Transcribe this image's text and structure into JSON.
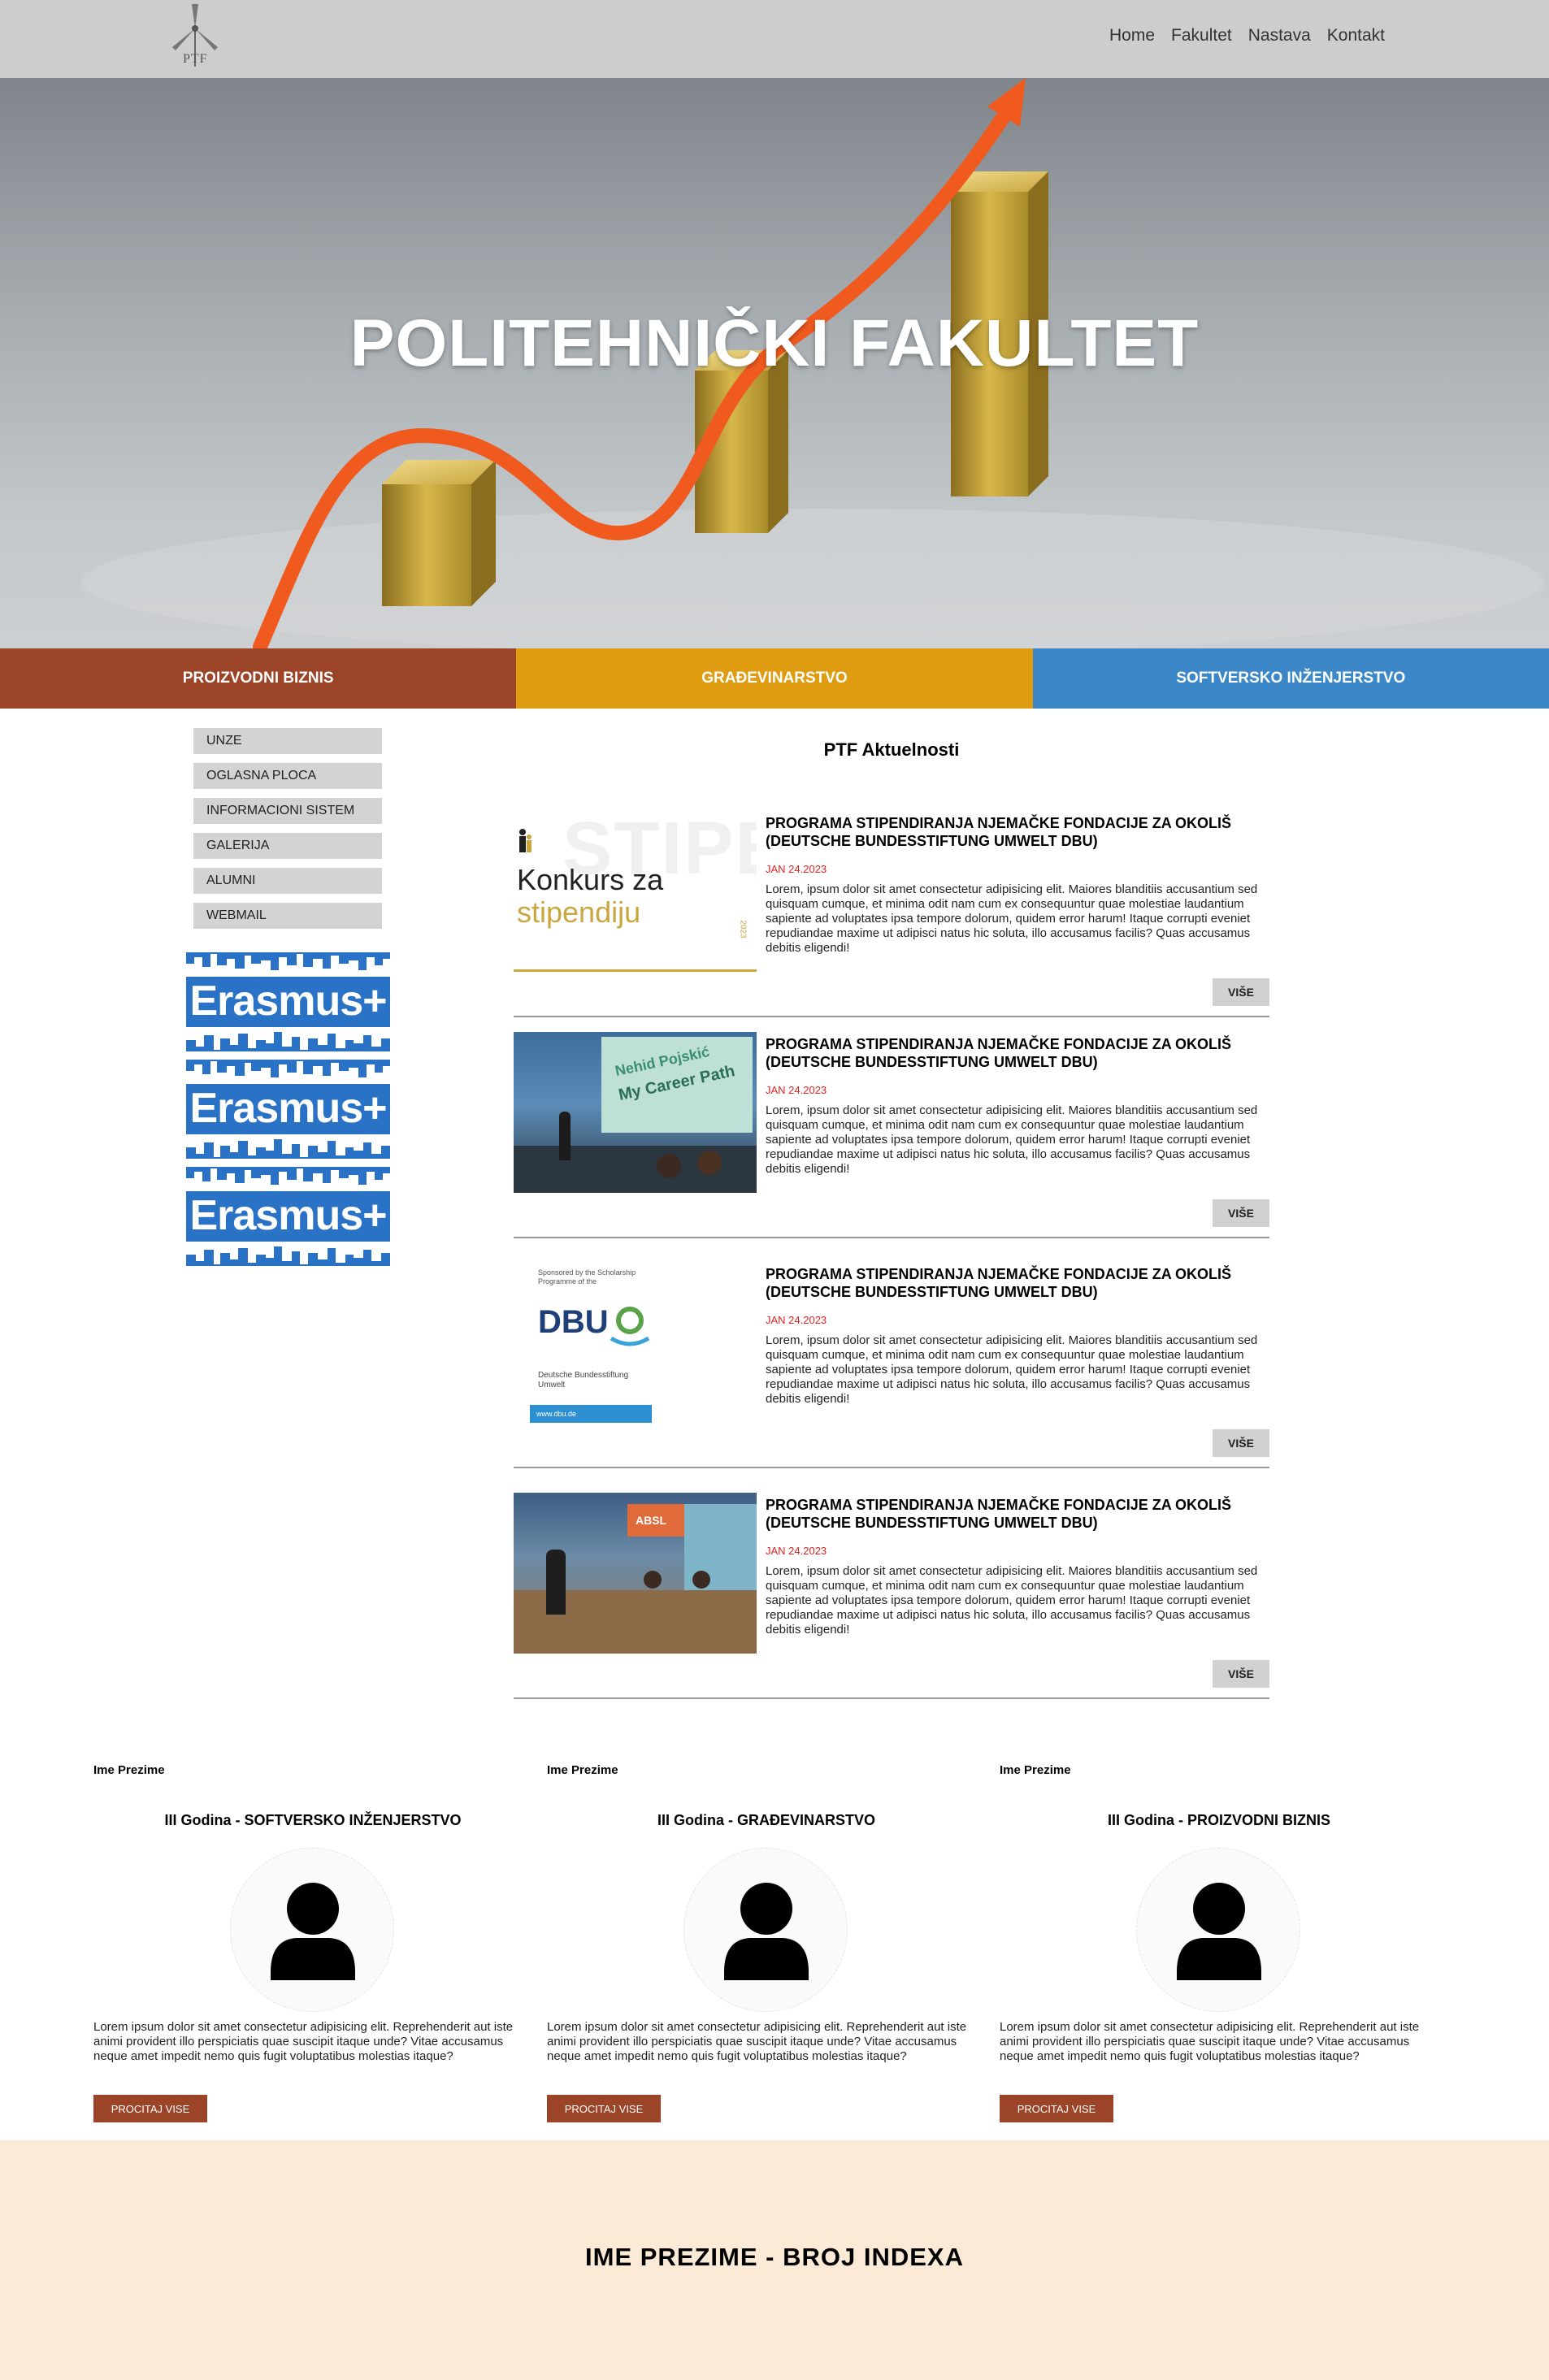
{
  "nav": {
    "logo_text": "PTF",
    "items": [
      {
        "label": "Home"
      },
      {
        "label": "Fakultet"
      },
      {
        "label": "Nastava"
      },
      {
        "label": "Kontakt"
      }
    ]
  },
  "hero": {
    "title": "POLITEHNIČKI FAKULTET"
  },
  "programs": [
    {
      "label": "PROIZVODNI BIZNIS",
      "color": "#9b4428"
    },
    {
      "label": "GRAĐEVINARSTVO",
      "color": "#e09c10"
    },
    {
      "label": "SOFTVERSKO INŽENJERSTVO",
      "color": "#3b87c8"
    }
  ],
  "sidebar": {
    "links": [
      {
        "label": "UNZE"
      },
      {
        "label": "OGLASNA PLOCA"
      },
      {
        "label": "INFORMACIONI SISTEM"
      },
      {
        "label": "GALERIJA"
      },
      {
        "label": "ALUMNI"
      },
      {
        "label": "WEBMAIL"
      }
    ],
    "banners": [
      {
        "label": "Erasmus+"
      },
      {
        "label": "Erasmus+"
      },
      {
        "label": "Erasmus+"
      }
    ]
  },
  "news": {
    "title": "PTF Aktuelnosti",
    "items": [
      {
        "headline": "PROGRAMA STIPENDIRANJA NJEMAČKE FONDACIJE ZA OKOLIŠ (DEUTSCHE BUNDESSTIFTUNG UMWELT DBU)",
        "date": "JAN 24.2023",
        "body": "Lorem, ipsum dolor sit amet consectetur adipisicing elit. Maiores blanditiis accusantium sed quisquam cumque, et minima odit nam cum ex consequuntur quae molestiae laudantium sapiente ad voluptates ipsa tempore dolorum, quidem error harum! Itaque corrupti eveniet repudiandae maxime ut adipisci natus hic soluta, illo accusamus facilis? Quas accusamus debitis eligendi!",
        "button": "VIŠE",
        "image": {
          "line1": "Konkurs za",
          "line2": "stipendiju",
          "watermark": "STIPEN",
          "year": "2023"
        }
      },
      {
        "headline": "PROGRAMA STIPENDIRANJA NJEMAČKE FONDACIJE ZA OKOLIŠ (DEUTSCHE BUNDESSTIFTUNG UMWELT DBU)",
        "date": "JAN 24.2023",
        "body": "Lorem, ipsum dolor sit amet consectetur adipisicing elit. Maiores blanditiis accusantium sed quisquam cumque, et minima odit nam cum ex consequuntur quae molestiae laudantium sapiente ad voluptates ipsa tempore dolorum, quidem error harum! Itaque corrupti eveniet repudiandae maxime ut adipisci natus hic soluta, illo accusamus facilis? Quas accusamus debitis eligendi!",
        "button": "VIŠE",
        "image": {
          "line1": "Nehid Pojskić",
          "line2": "My Career Path"
        }
      },
      {
        "headline": "PROGRAMA STIPENDIRANJA NJEMAČKE FONDACIJE ZA OKOLIŠ (DEUTSCHE BUNDESSTIFTUNG UMWELT DBU)",
        "date": "JAN 24.2023",
        "body": "Lorem, ipsum dolor sit amet consectetur adipisicing elit. Maiores blanditiis accusantium sed quisquam cumque, et minima odit nam cum ex consequuntur quae molestiae laudantium sapiente ad voluptates ipsa tempore dolorum, quidem error harum! Itaque corrupti eveniet repudiandae maxime ut adipisci natus hic soluta, illo accusamus facilis? Quas accusamus debitis eligendi!",
        "button": "VIŠE",
        "image": {
          "sponsor": "Sponsored by the Scholarship Programme of the",
          "logo": "DBU",
          "org": "Deutsche Bundesstiftung Umwelt",
          "url": "www.dbu.de"
        }
      },
      {
        "headline": "PROGRAMA STIPENDIRANJA NJEMAČKE FONDACIJE ZA OKOLIŠ (DEUTSCHE BUNDESSTIFTUNG UMWELT DBU)",
        "date": "JAN 24.2023",
        "body": "Lorem, ipsum dolor sit amet consectetur adipisicing elit. Maiores blanditiis accusantium sed quisquam cumque, et minima odit nam cum ex consequuntur quae molestiae laudantium sapiente ad voluptates ipsa tempore dolorum, quidem error harum! Itaque corrupti eveniet repudiandae maxime ut adipisci natus hic soluta, illo accusamus facilis? Quas accusamus debitis eligendi!",
        "button": "VIŠE",
        "image": {
          "sign": "ABSL"
        }
      }
    ]
  },
  "students": [
    {
      "name": "Ime Prezime",
      "year": "III Godina - SOFTVERSKO INŽENJERSTVO",
      "text": "Lorem ipsum dolor sit amet consectetur adipisicing elit. Reprehenderit aut iste animi provident illo perspiciatis quae suscipit itaque unde? Vitae accusamus neque amet impedit nemo quis fugit voluptatibus molestias itaque?",
      "button": "PROCITAJ VISE"
    },
    {
      "name": "Ime Prezime",
      "year": "III Godina - GRAĐEVINARSTVO",
      "text": "Lorem ipsum dolor sit amet consectetur adipisicing elit. Reprehenderit aut iste animi provident illo perspiciatis quae suscipit itaque unde? Vitae accusamus neque amet impedit nemo quis fugit voluptatibus molestias itaque?",
      "button": "PROCITAJ VISE"
    },
    {
      "name": "Ime Prezime",
      "year": "III Godina - PROIZVODNI BIZNIS",
      "text": "Lorem ipsum dolor sit amet consectetur adipisicing elit. Reprehenderit aut iste animi provident illo perspiciatis quae suscipit itaque unde? Vitae accusamus neque amet impedit nemo quis fugit voluptatibus molestias itaque?",
      "button": "PROCITAJ VISE"
    }
  ],
  "footer": {
    "text": "IME PREZIME - BROJ INDEXA"
  }
}
